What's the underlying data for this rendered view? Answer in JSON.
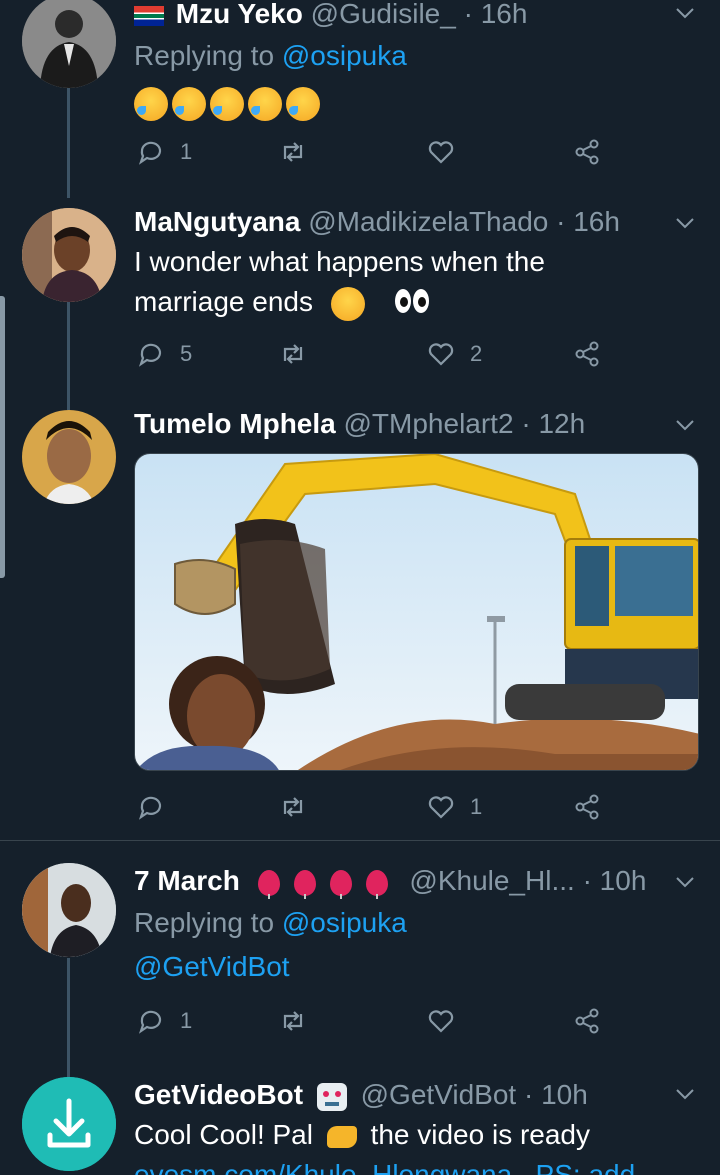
{
  "tweets": [
    {
      "name": "Mzu Yeko",
      "handle": "@Gudisile_",
      "time": "16h",
      "replying_prefix": "Replying to",
      "replying_to": "@osipuka",
      "text": "",
      "emojis": [
        "rolling-on-floor-laughing",
        "rolling-on-floor-laughing",
        "rolling-on-floor-laughing",
        "rolling-on-floor-laughing",
        "rolling-on-floor-laughing"
      ],
      "replies": "1",
      "retweets": "",
      "likes": ""
    },
    {
      "name": "MaNgutyana",
      "handle": "@MadikizelaThado",
      "time": "16h",
      "line1": "I wonder what happens when the",
      "line2": "marriage ends",
      "replies": "5",
      "retweets": "",
      "likes": "2"
    },
    {
      "name": "Tumelo Mphela",
      "handle": "@TMphelart2",
      "time": "12h",
      "media": "excavator lifting hair weave meme",
      "replies": "",
      "retweets": "",
      "likes": "1"
    },
    {
      "name": "7 March",
      "handle": "@Khule_Hl...",
      "time": "10h",
      "replying_prefix": "Replying to",
      "replying_to": "@osipuka",
      "text": "@GetVidBot",
      "replies": "1",
      "retweets": "",
      "likes": ""
    },
    {
      "name": "GetVideoBot",
      "handle": "@GetVidBot",
      "time": "10h",
      "line1a": "Cool Cool! Pal",
      "line1b": "the video is ready",
      "line2": "evesm.com/Khule_Hlongwana . PS: add"
    }
  ],
  "separator": "·",
  "colors": {
    "background": "#15202b",
    "accent": "#1da1f2",
    "muted": "#8899a6",
    "divider": "#38444d"
  }
}
